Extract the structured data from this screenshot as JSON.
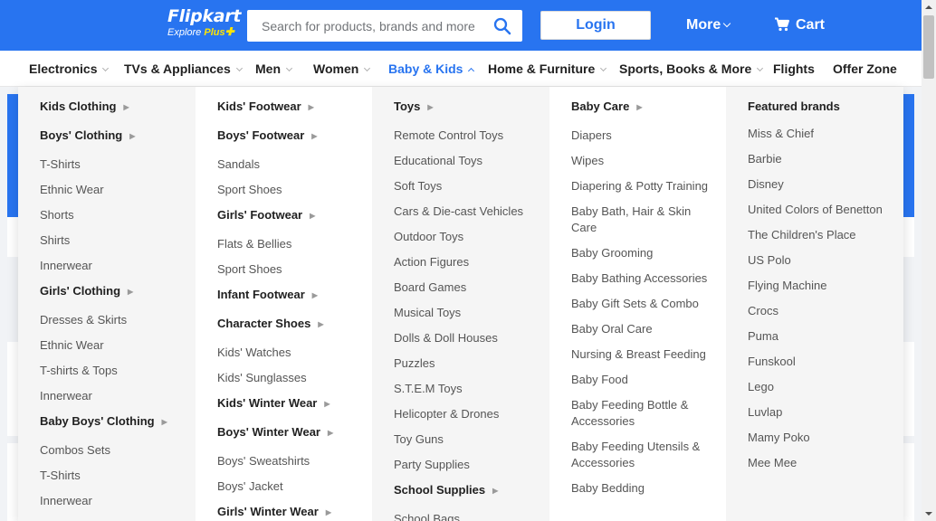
{
  "header": {
    "logo_text": "Flipkart",
    "logo_tagline_explore": "Explore",
    "logo_tagline_plus": "Plus",
    "search_placeholder": "Search for products, brands and more",
    "login_label": "Login",
    "more_label": "More",
    "cart_label": "Cart"
  },
  "colors": {
    "brand_blue": "#2874f0",
    "logo_yellow": "#ffe500"
  },
  "nav": {
    "categories": [
      {
        "label": "Electronics",
        "active": false
      },
      {
        "label": "TVs & Appliances",
        "active": false
      },
      {
        "label": "Men",
        "active": false
      },
      {
        "label": "Women",
        "active": false
      },
      {
        "label": "Baby & Kids",
        "active": true
      },
      {
        "label": "Home & Furniture",
        "active": false
      },
      {
        "label": "Sports, Books & More",
        "active": false
      },
      {
        "label": "Flights",
        "active": false
      },
      {
        "label": "Offer Zone",
        "active": false
      }
    ]
  },
  "menu": {
    "columns": [
      {
        "items": [
          {
            "label": "Kids Clothing",
            "head": true
          },
          {
            "label": "Boys' Clothing",
            "head": true
          },
          {
            "label": "T-Shirts"
          },
          {
            "label": "Ethnic Wear"
          },
          {
            "label": "Shorts"
          },
          {
            "label": "Shirts"
          },
          {
            "label": "Innerwear"
          },
          {
            "label": "Girls' Clothing",
            "head": true
          },
          {
            "label": "Dresses & Skirts"
          },
          {
            "label": "Ethnic Wear"
          },
          {
            "label": "T-shirts & Tops"
          },
          {
            "label": "Innerwear"
          },
          {
            "label": "Baby Boys' Clothing",
            "head": true
          },
          {
            "label": "Combos Sets"
          },
          {
            "label": "T-Shirts"
          },
          {
            "label": "Innerwear"
          }
        ]
      },
      {
        "items": [
          {
            "label": "Kids' Footwear",
            "head": true
          },
          {
            "label": "Boys' Footwear",
            "head": true
          },
          {
            "label": "Sandals"
          },
          {
            "label": "Sport Shoes"
          },
          {
            "label": "Girls' Footwear",
            "head": true
          },
          {
            "label": "Flats & Bellies"
          },
          {
            "label": "Sport Shoes"
          },
          {
            "label": "Infant Footwear",
            "head": true
          },
          {
            "label": "Character Shoes",
            "head": true
          },
          {
            "label": "Kids' Watches"
          },
          {
            "label": "Kids' Sunglasses"
          },
          {
            "label": "Kids' Winter Wear",
            "head": true
          },
          {
            "label": "Boys' Winter Wear",
            "head": true
          },
          {
            "label": "Boys' Sweatshirts"
          },
          {
            "label": "Boys' Jacket"
          },
          {
            "label": "Girls' Winter Wear",
            "head": true
          }
        ]
      },
      {
        "items": [
          {
            "label": "Toys",
            "head": true
          },
          {
            "label": "Remote Control Toys"
          },
          {
            "label": "Educational Toys"
          },
          {
            "label": "Soft Toys"
          },
          {
            "label": "Cars & Die-cast Vehicles"
          },
          {
            "label": "Outdoor Toys"
          },
          {
            "label": "Action Figures"
          },
          {
            "label": "Board Games"
          },
          {
            "label": "Musical Toys"
          },
          {
            "label": "Dolls & Doll Houses"
          },
          {
            "label": "Puzzles"
          },
          {
            "label": "S.T.E.M Toys"
          },
          {
            "label": "Helicopter & Drones"
          },
          {
            "label": "Toy Guns"
          },
          {
            "label": "Party Supplies"
          },
          {
            "label": "School Supplies",
            "head": true
          },
          {
            "label": "School Bags"
          }
        ]
      },
      {
        "items": [
          {
            "label": "Baby Care",
            "head": true
          },
          {
            "label": "Diapers"
          },
          {
            "label": "Wipes"
          },
          {
            "label": "Diapering & Potty Training"
          },
          {
            "label": "Baby Bath, Hair & Skin Care"
          },
          {
            "label": "Baby Grooming"
          },
          {
            "label": "Baby Bathing Accessories"
          },
          {
            "label": "Baby Gift Sets & Combo"
          },
          {
            "label": "Baby Oral Care"
          },
          {
            "label": "Nursing & Breast Feeding"
          },
          {
            "label": "Baby Food"
          },
          {
            "label": "Baby Feeding Bottle & Accessories"
          },
          {
            "label": "Baby Feeding Utensils & Accessories"
          },
          {
            "label": "Baby Bedding"
          }
        ]
      },
      {
        "items": [
          {
            "label": "Featured brands",
            "head": true,
            "noarrow": true
          },
          {
            "label": "Miss & Chief"
          },
          {
            "label": "Barbie"
          },
          {
            "label": "Disney"
          },
          {
            "label": "United Colors of Benetton"
          },
          {
            "label": "The Children's Place"
          },
          {
            "label": "US Polo"
          },
          {
            "label": "Flying Machine"
          },
          {
            "label": "Crocs"
          },
          {
            "label": "Puma"
          },
          {
            "label": "Funskool"
          },
          {
            "label": "Lego"
          },
          {
            "label": "Luvlap"
          },
          {
            "label": "Mamy Poko"
          },
          {
            "label": "Mee Mee"
          }
        ]
      }
    ]
  }
}
